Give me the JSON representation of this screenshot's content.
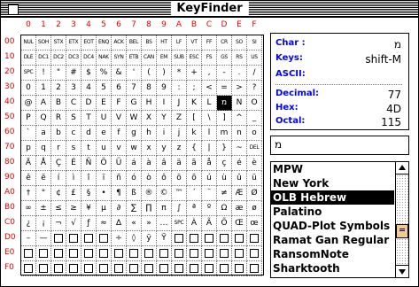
{
  "window": {
    "title": "KeyFinder"
  },
  "col_headers": [
    "0",
    "1",
    "2",
    "3",
    "4",
    "5",
    "6",
    "7",
    "8",
    "9",
    "A",
    "B",
    "C",
    "D",
    "E",
    "F"
  ],
  "row_headers": [
    "00",
    "10",
    "20",
    "30",
    "40",
    "50",
    "60",
    "70",
    "80",
    "90",
    "A0",
    "B0",
    "C0",
    "D0",
    "E0",
    "F0"
  ],
  "grid": [
    [
      "NUL",
      "SOH",
      "STX",
      "ETX",
      "EOT",
      "ENQ",
      "ACK",
      "BEL",
      "BS",
      "HT",
      "LF",
      "VT",
      "FF",
      "CR",
      "SO",
      "SI"
    ],
    [
      "DLE",
      "DC1",
      "DC2",
      "DC3",
      "DC4",
      "NAK",
      "SYN",
      "ETB",
      "CAN",
      "EM",
      "SUB",
      "ESC",
      "FS",
      "GS",
      "RS",
      "US"
    ],
    [
      "SPC",
      "!",
      "\"",
      "#",
      "$",
      "%",
      "&",
      "'",
      "(",
      ")",
      "*",
      "+",
      ",",
      "-",
      ".",
      "/"
    ],
    [
      "0",
      "1",
      "2",
      "3",
      "4",
      "5",
      "6",
      "7",
      "8",
      "9",
      ":",
      ";",
      "<",
      "=",
      ">",
      "?"
    ],
    [
      "@",
      "A",
      "B",
      "C",
      "D",
      "E",
      "F",
      "G",
      "H",
      "I",
      "J",
      "K",
      "L",
      "מ",
      "N",
      "O"
    ],
    [
      "P",
      "Q",
      "R",
      "S",
      "T",
      "U",
      "V",
      "W",
      "X",
      "Y",
      "Z",
      "[",
      "\\",
      "]",
      "^",
      "_"
    ],
    [
      "`",
      "a",
      "b",
      "c",
      "d",
      "e",
      "f",
      "g",
      "h",
      "i",
      "j",
      "k",
      "l",
      "m",
      "n",
      "o"
    ],
    [
      "p",
      "q",
      "r",
      "s",
      "t",
      "u",
      "v",
      "w",
      "x",
      "y",
      "z",
      "{",
      "|",
      "}",
      "~",
      "DEL"
    ],
    [
      "Ä",
      "Å",
      "Ç",
      "É",
      "Ñ",
      "Ö",
      "Ü",
      "á",
      "à",
      "â",
      "ä",
      "ã",
      "å",
      "ç",
      "é",
      "è"
    ],
    [
      "ê",
      "ë",
      "í",
      "ì",
      "î",
      "ï",
      "ñ",
      "ó",
      "ò",
      "ô",
      "ö",
      "õ",
      "ú",
      "ù",
      "û",
      "ü"
    ],
    [
      "†",
      "°",
      "¢",
      "£",
      "§",
      "•",
      "¶",
      "ß",
      "®",
      "©",
      "™",
      "´",
      "¨",
      "≠",
      "Æ",
      "Ø"
    ],
    [
      "∞",
      "±",
      "≤",
      "≥",
      "¥",
      "µ",
      "∂",
      "∑",
      "∏",
      "π",
      "∫",
      "ª",
      "º",
      "Ω",
      "æ",
      "ø"
    ],
    [
      "¿",
      "¡",
      "¬",
      "√",
      "ƒ",
      "≈",
      "∆",
      "«",
      "»",
      "…",
      "SPC",
      "À",
      "Ã",
      "Õ",
      "Œ",
      "œ"
    ],
    [
      "–",
      "—",
      "□",
      "□",
      "□",
      "□",
      "÷",
      "◊",
      "ÿ",
      "Ÿ",
      "□",
      "□",
      "□",
      "□",
      "□",
      "□"
    ],
    [
      "□",
      "□",
      "□",
      "□",
      "□",
      "□",
      "□",
      "□",
      "□",
      "□",
      "□",
      "□",
      "□",
      "□",
      "□",
      "□"
    ],
    [
      "□",
      "□",
      "□",
      "□",
      "□",
      "□",
      "□",
      "□",
      "□",
      "□",
      "□",
      "□",
      "□",
      "□",
      "□",
      "□"
    ]
  ],
  "selected_cell": {
    "row": 4,
    "col": 13
  },
  "info": {
    "char_label": "Char :",
    "char_value": "מ",
    "keys_label": "Keys:",
    "keys_value": "shift-M",
    "ascii_label": "ASCII:",
    "decimal_label": "Decimal:",
    "decimal_value": "77",
    "hex_label": "Hex:",
    "hex_value": "4D",
    "octal_label": "Octal:",
    "octal_value": "115"
  },
  "char_field": {
    "value": "מ"
  },
  "fonts": {
    "items": [
      "MPW",
      "New York",
      "OLB Hebrew",
      "Palatino",
      "QUAD-Plot Symbols",
      "Ramat Gan Regular",
      "RansomNote",
      "Sharktooth"
    ],
    "selected_index": 2,
    "scroll_fraction": 0.65
  },
  "colors": {
    "header_red": "#dd0000",
    "label_blue": "#0000ff",
    "thumb": "#f4c890"
  }
}
